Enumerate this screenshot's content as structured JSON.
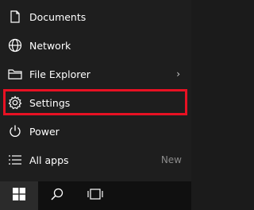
{
  "menu": {
    "items": [
      {
        "label": "Documents",
        "icon": "document-icon"
      },
      {
        "label": "Network",
        "icon": "network-icon"
      },
      {
        "label": "File Explorer",
        "icon": "folder-icon",
        "chevron": "›"
      },
      {
        "label": "Settings",
        "icon": "gear-icon"
      },
      {
        "label": "Power",
        "icon": "power-icon"
      },
      {
        "label": "All apps",
        "icon": "list-icon",
        "badge": "New"
      }
    ]
  },
  "taskbar": {
    "buttons": [
      {
        "icon": "windows-start-icon"
      },
      {
        "icon": "search-icon"
      },
      {
        "icon": "task-view-icon"
      }
    ]
  },
  "colors": {
    "highlight": "#e81123",
    "text": "#ffffff",
    "menu_bg": "#1e1e1e",
    "taskbar_bg": "#101010"
  }
}
